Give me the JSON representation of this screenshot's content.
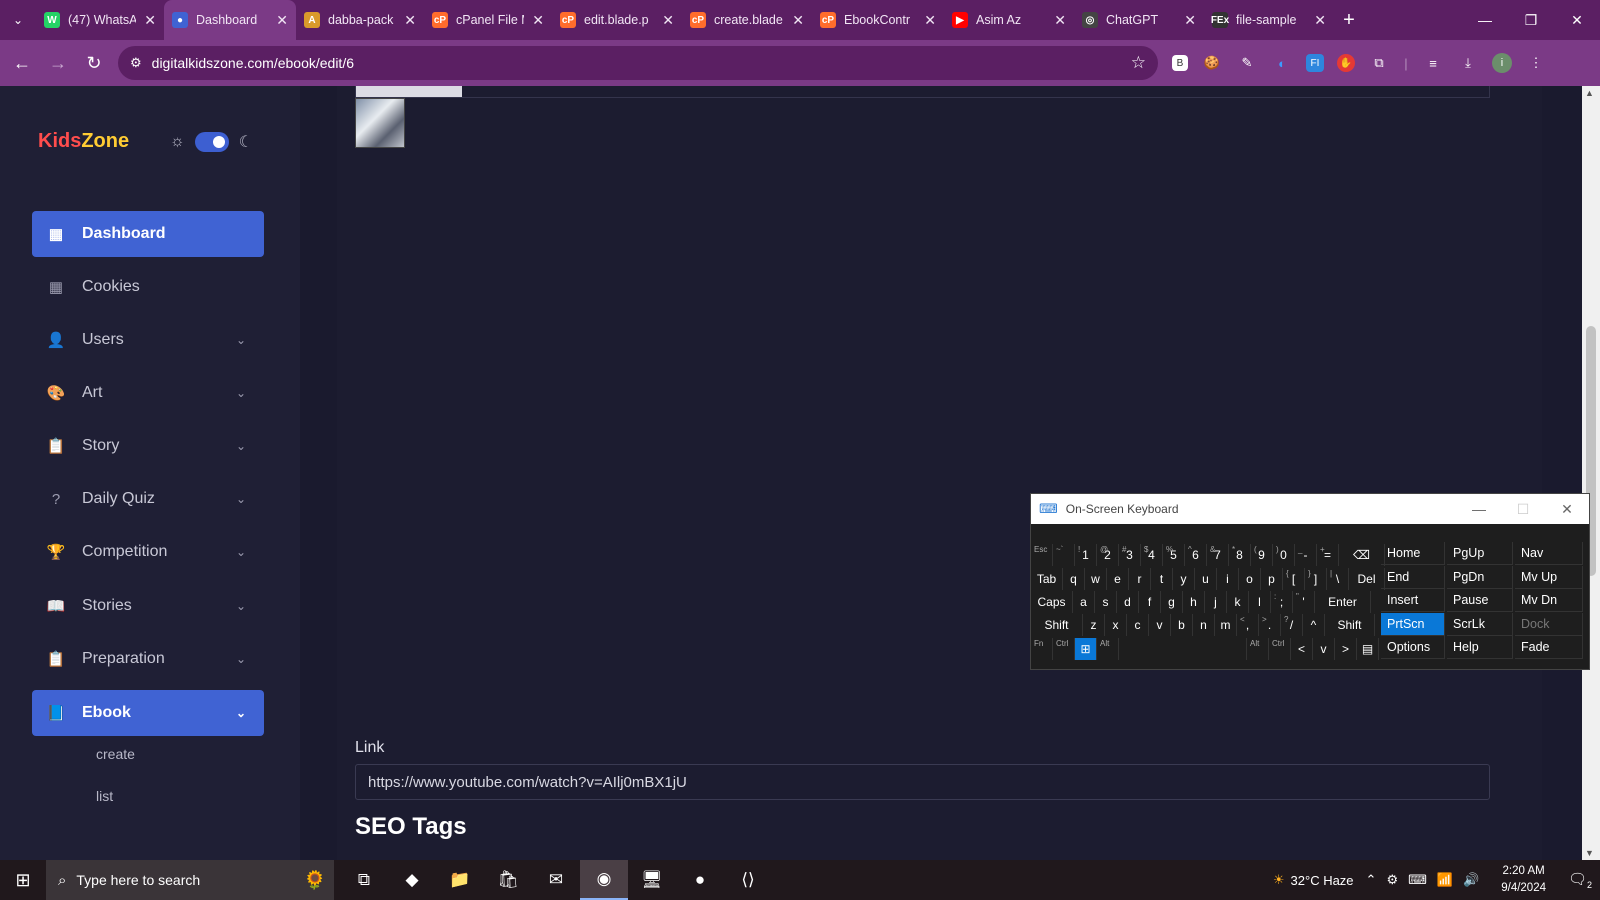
{
  "browser": {
    "tabs": [
      {
        "title": "(47) WhatsA",
        "icon": "whatsapp-icon",
        "color": "#25d366",
        "glyph": "W"
      },
      {
        "title": "Dashboard",
        "icon": "dashboard-favicon",
        "color": "#4063d3",
        "glyph": "●"
      },
      {
        "title": "dabba-pack",
        "icon": "dabba-icon",
        "color": "#d99a2b",
        "glyph": "A"
      },
      {
        "title": "cPanel File M",
        "icon": "cpanel-icon",
        "color": "#ff6c2c",
        "glyph": "cP"
      },
      {
        "title": "edit.blade.p",
        "icon": "cpanel-icon",
        "color": "#ff6c2c",
        "glyph": "cP"
      },
      {
        "title": "create.blade",
        "icon": "cpanel-icon",
        "color": "#ff6c2c",
        "glyph": "cP"
      },
      {
        "title": "EbookContr",
        "icon": "cpanel-icon",
        "color": "#ff6c2c",
        "glyph": "cP"
      },
      {
        "title": "Asim Az",
        "icon": "youtube-icon",
        "color": "#ff0000",
        "glyph": "▶"
      },
      {
        "title": "ChatGPT",
        "icon": "chatgpt-icon",
        "color": "#444",
        "glyph": "◎"
      },
      {
        "title": "file-sample",
        "icon": "fex-icon",
        "color": "#333",
        "glyph": "FEx"
      }
    ],
    "active_tab": 1,
    "url": "digitalkidszone.com/ebook/edit/6"
  },
  "sidebar": {
    "logo": {
      "part1": "Kids",
      "part2": "Zone"
    },
    "items": [
      {
        "label": "Dashboard",
        "icon": "dashboard-icon",
        "glyph": "▦",
        "chevron": false,
        "active": true
      },
      {
        "label": "Cookies",
        "icon": "cookies-icon",
        "glyph": "▦",
        "chevron": false,
        "active": false
      },
      {
        "label": "Users",
        "icon": "user-icon",
        "glyph": "👤",
        "chevron": true,
        "active": false
      },
      {
        "label": "Art",
        "icon": "palette-icon",
        "glyph": "🎨",
        "chevron": true,
        "active": false
      },
      {
        "label": "Story",
        "icon": "story-icon",
        "glyph": "📋",
        "chevron": true,
        "active": false
      },
      {
        "label": "Daily Quiz",
        "icon": "question-icon",
        "glyph": "?",
        "chevron": true,
        "active": false
      },
      {
        "label": "Competition",
        "icon": "trophy-icon",
        "glyph": "🏆",
        "chevron": true,
        "active": false
      },
      {
        "label": "Stories",
        "icon": "book-open-icon",
        "glyph": "📖",
        "chevron": true,
        "active": false
      },
      {
        "label": "Preparation",
        "icon": "preparation-icon",
        "glyph": "📋",
        "chevron": true,
        "active": false
      },
      {
        "label": "Ebook",
        "icon": "book-icon",
        "glyph": "📘",
        "chevron": true,
        "active": true
      }
    ],
    "subitems": [
      "create",
      "list"
    ]
  },
  "main": {
    "link_label": "Link",
    "link_value": "https://www.youtube.com/watch?v=AIlj0mBX1jU",
    "seo_heading": "SEO Tags"
  },
  "osk": {
    "title": "On-Screen Keyboard",
    "rows": [
      [
        {
          "k": "",
          "s": "Esc",
          "w": 22
        },
        {
          "k": "",
          "s": "~`",
          "w": 22
        },
        {
          "k": "1",
          "s": "!",
          "w": 22
        },
        {
          "k": "2",
          "s": "@",
          "w": 22
        },
        {
          "k": "3",
          "s": "#",
          "w": 22
        },
        {
          "k": "4",
          "s": "$",
          "w": 22
        },
        {
          "k": "5",
          "s": "%",
          "w": 22
        },
        {
          "k": "6",
          "s": "^",
          "w": 22
        },
        {
          "k": "7",
          "s": "&",
          "w": 22
        },
        {
          "k": "8",
          "s": "*",
          "w": 22
        },
        {
          "k": "9",
          "s": "(",
          "w": 22
        },
        {
          "k": "0",
          "s": ")",
          "w": 22
        },
        {
          "k": "-",
          "s": "_",
          "w": 22
        },
        {
          "k": "=",
          "s": "+",
          "w": 22
        },
        {
          "k": "⌫",
          "s": "",
          "w": 46
        }
      ],
      [
        {
          "k": "Tab",
          "s": "",
          "w": 32
        },
        {
          "k": "q",
          "s": "",
          "w": 22
        },
        {
          "k": "w",
          "s": "",
          "w": 22
        },
        {
          "k": "e",
          "s": "",
          "w": 22
        },
        {
          "k": "r",
          "s": "",
          "w": 22
        },
        {
          "k": "t",
          "s": "",
          "w": 22
        },
        {
          "k": "y",
          "s": "",
          "w": 22
        },
        {
          "k": "u",
          "s": "",
          "w": 22
        },
        {
          "k": "i",
          "s": "",
          "w": 22
        },
        {
          "k": "o",
          "s": "",
          "w": 22
        },
        {
          "k": "p",
          "s": "",
          "w": 22
        },
        {
          "k": "[",
          "s": "{",
          "w": 22
        },
        {
          "k": "]",
          "s": "}",
          "w": 22
        },
        {
          "k": "\\",
          "s": "|",
          "w": 22
        },
        {
          "k": "Del",
          "s": "",
          "w": 36
        }
      ],
      [
        {
          "k": "Caps",
          "s": "",
          "w": 42
        },
        {
          "k": "a",
          "s": "",
          "w": 22
        },
        {
          "k": "s",
          "s": "",
          "w": 22
        },
        {
          "k": "d",
          "s": "",
          "w": 22
        },
        {
          "k": "f",
          "s": "",
          "w": 22
        },
        {
          "k": "g",
          "s": "",
          "w": 22
        },
        {
          "k": "h",
          "s": "",
          "w": 22
        },
        {
          "k": "j",
          "s": "",
          "w": 22
        },
        {
          "k": "k",
          "s": "",
          "w": 22
        },
        {
          "k": "l",
          "s": "",
          "w": 22
        },
        {
          "k": ";",
          "s": ":",
          "w": 22
        },
        {
          "k": "'",
          "s": "\"",
          "w": 22
        },
        {
          "k": "Enter",
          "s": "",
          "w": 56
        }
      ],
      [
        {
          "k": "Shift",
          "s": "",
          "w": 52
        },
        {
          "k": "z",
          "s": "",
          "w": 22
        },
        {
          "k": "x",
          "s": "",
          "w": 22
        },
        {
          "k": "c",
          "s": "",
          "w": 22
        },
        {
          "k": "v",
          "s": "",
          "w": 22
        },
        {
          "k": "b",
          "s": "",
          "w": 22
        },
        {
          "k": "n",
          "s": "",
          "w": 22
        },
        {
          "k": "m",
          "s": "",
          "w": 22
        },
        {
          "k": ",",
          "s": "<",
          "w": 22
        },
        {
          "k": ".",
          "s": ">",
          "w": 22
        },
        {
          "k": "/",
          "s": "?",
          "w": 22
        },
        {
          "k": "^",
          "s": "",
          "w": 22
        },
        {
          "k": "Shift",
          "s": "",
          "w": 50
        }
      ],
      [
        {
          "k": "",
          "s": "Fn",
          "w": 22
        },
        {
          "k": "",
          "s": "Ctrl",
          "w": 22
        },
        {
          "k": "⊞",
          "s": "",
          "w": 22,
          "hl": true
        },
        {
          "k": "",
          "s": "Alt",
          "w": 22
        },
        {
          "k": "",
          "s": "",
          "w": 128
        },
        {
          "k": "",
          "s": "Alt",
          "w": 22
        },
        {
          "k": "",
          "s": "Ctrl",
          "w": 22
        },
        {
          "k": "<",
          "s": "",
          "w": 22
        },
        {
          "k": "v",
          "s": "",
          "w": 22
        },
        {
          "k": ">",
          "s": "",
          "w": 22
        },
        {
          "k": "▤",
          "s": "",
          "w": 22
        }
      ]
    ],
    "nav_cols": [
      [
        {
          "k": "Home"
        },
        {
          "k": "End"
        },
        {
          "k": "Insert"
        },
        {
          "k": "PrtScn",
          "hl": true
        },
        {
          "k": "Options"
        }
      ],
      [
        {
          "k": "PgUp"
        },
        {
          "k": "PgDn"
        },
        {
          "k": "Pause"
        },
        {
          "k": "ScrLk"
        },
        {
          "k": "Help"
        }
      ],
      [
        {
          "k": "Nav"
        },
        {
          "k": "Mv Up"
        },
        {
          "k": "Mv Dn"
        },
        {
          "k": "Dock",
          "dim": true
        },
        {
          "k": "Fade"
        }
      ]
    ]
  },
  "taskbar": {
    "search_placeholder": "Type here to search",
    "apps": [
      {
        "icon": "task-view-icon",
        "glyph": "⧉"
      },
      {
        "icon": "copilot-icon",
        "glyph": "◆"
      },
      {
        "icon": "file-explorer-icon",
        "glyph": "📁"
      },
      {
        "icon": "store-icon",
        "glyph": "🛍"
      },
      {
        "icon": "mail-icon",
        "glyph": "✉"
      },
      {
        "icon": "chrome-icon",
        "glyph": "◉",
        "active": true
      },
      {
        "icon": "remote-desktop-icon",
        "glyph": "🖥"
      },
      {
        "icon": "github-icon",
        "glyph": "●"
      },
      {
        "icon": "vscode-icon",
        "glyph": "⟨⟩"
      }
    ],
    "weather": "32°C  Haze",
    "time": "2:20 AM",
    "date": "9/4/2024",
    "notifications": "2"
  }
}
